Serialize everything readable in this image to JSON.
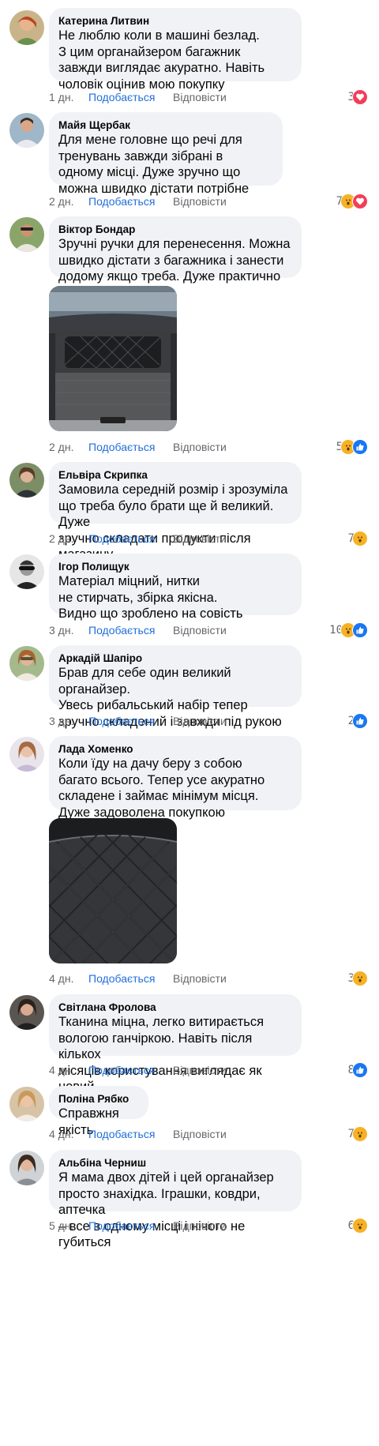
{
  "comments": [
    {
      "name": "Катерина Литвин",
      "text": "Не люблю коли в машині безлад.\nЗ цим органайзером багажник\nзавжди виглядає акуратно. Навіть\nчоловік оцінив мою покупку",
      "time": "1 дн.",
      "like_label": "Подобається",
      "reply_label": "Відповісти",
      "count": "3",
      "reactions": [
        "heart-icon"
      ]
    },
    {
      "name": "Майя Щербак",
      "text": "Для мене головне що речі для\nтренувань завжди зібрані в\nодному місці. Дуже зручно що\nможна швидко дістати потрібне",
      "time": "2 дн.",
      "like_label": "Подобається",
      "reply_label": "Відповісти",
      "count": "7",
      "reactions": [
        "wow-icon",
        "heart-icon"
      ]
    },
    {
      "name": "Віктор Бондар",
      "text": "Зручні ручки для перенесення. Можна\nшвидко дістати з багажника і занести\nдодому якщо треба. Дуже практично",
      "time": "2 дн.",
      "like_label": "Подобається",
      "reply_label": "Відповісти",
      "count": "5",
      "reactions": [
        "wow-icon",
        "like-icon"
      ]
    },
    {
      "name": "Ельвіра Скрипка",
      "text": "Замовила середній розмір і зрозуміла\nщо треба було брати ще й великий. Дуже\nзручно складати продукти після магазину",
      "time": "2 дн.",
      "like_label": "Подобається",
      "reply_label": "Відповісти",
      "count": "7",
      "reactions": [
        "wow-icon"
      ]
    },
    {
      "name": "Ігор Полищук",
      "text": "Матеріал міцний, нитки\nне стирчать, збірка якісна.\nВидно що зроблено на совість",
      "time": "3 дн.",
      "like_label": "Подобається",
      "reply_label": "Відповісти",
      "count": "10",
      "reactions": [
        "wow-icon",
        "like-icon"
      ]
    },
    {
      "name": "Аркадій Шапіро",
      "text": "Брав для себе один великий органайзер.\nУвесь рибальський набір тепер\nзручно складений і завжди під рукою",
      "time": "3 дн.",
      "like_label": "Подобається",
      "reply_label": "Відповісти",
      "count": "2",
      "reactions": [
        "like-icon"
      ]
    },
    {
      "name": "Лада Хоменко",
      "text": "Коли їду на дачу беру з собою\nбагато всього. Тепер усе акуратно\nскладене і займає мінімум місця.\nДуже задоволена покупкою",
      "time": "4 дн.",
      "like_label": "Подобається",
      "reply_label": "Відповісти",
      "count": "3",
      "reactions": [
        "wow-icon"
      ]
    },
    {
      "name": "Світлана Фролова",
      "text": "Тканина міцна, легко витирається\nвологою ганчіркою. Навіть після кількох\nмісяців користування виглядає як новий",
      "time": "4 дн.",
      "like_label": "Подобається",
      "reply_label": "Відповісти",
      "count": "8",
      "reactions": [
        "like-icon"
      ]
    },
    {
      "name": "Поліна Рябко",
      "text": "Справжня якість",
      "time": "4 дн.",
      "like_label": "Подобається",
      "reply_label": "Відповісти",
      "count": "7",
      "reactions": [
        "wow-icon"
      ]
    },
    {
      "name": "Альбіна Черниш",
      "text": "Я мама двох дітей і цей органайзер\nпросто знахідка. Іграшки, ковдри, аптечка\n– все в одному місці і нічого не губиться",
      "time": "5 дн.",
      "like_label": "Подобається",
      "reply_label": "Відповісти",
      "count": "6",
      "reactions": [
        "wow-icon"
      ]
    }
  ],
  "colors": {
    "bubble": "#f0f2f5",
    "like_link": "#216fdb",
    "meta": "#65676b",
    "heart": "#f33e58",
    "wow": "#f7b125",
    "like_reaction": "#1877f2"
  }
}
